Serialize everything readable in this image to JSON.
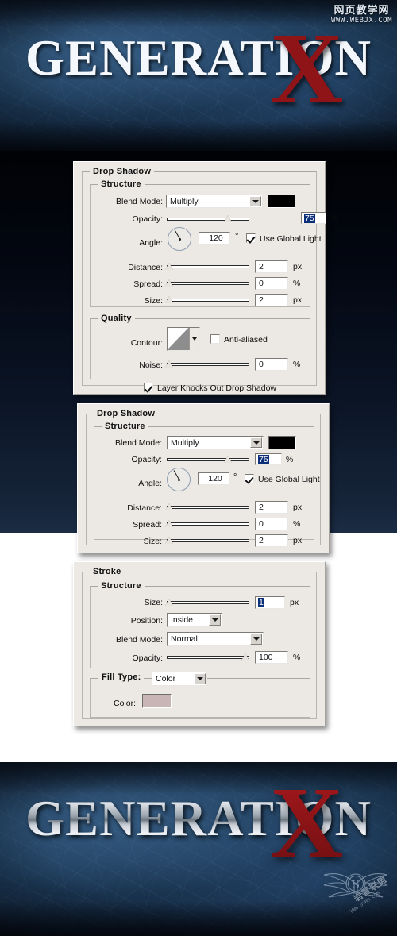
{
  "banners": {
    "top": {
      "wordmark": "GENERATIO N",
      "wordmark_text": "GENERATION",
      "accent_letter": "X",
      "style": "white-serif",
      "bg_color": "#1d3a58",
      "accent_color": "#8e1417"
    },
    "bottom": {
      "wordmark_text": "GENERATION",
      "accent_letter": "X",
      "style": "metallic-silver",
      "bg_color": "#1d3a58",
      "accent_color": "#8e1417"
    }
  },
  "watermarks": {
    "top": {
      "cn": "网页教学网",
      "url": "WWW.WEBJX.COM"
    },
    "bottom": {
      "icon": "winged-s-emblem",
      "cn": "岩冒联盟",
      "url": "WWW.5VHH.COM"
    }
  },
  "dialogs": [
    {
      "id": "drop-shadow-full",
      "title": "Drop Shadow",
      "sections": [
        {
          "title": "Structure",
          "fields": {
            "blend_mode_label": "Blend Mode:",
            "blend_mode_value": "Multiply",
            "blend_mode_color": "#000000",
            "opacity_label": "Opacity:",
            "opacity_value": "75",
            "opacity_unit": "%",
            "angle_label": "Angle:",
            "angle_value": "120",
            "angle_unit": "°",
            "global_light_label": "Use Global Light",
            "global_light_checked": true,
            "distance_label": "Distance:",
            "distance_value": "2",
            "distance_unit": "px",
            "spread_label": "Spread:",
            "spread_value": "0",
            "spread_unit": "%",
            "size_label": "Size:",
            "size_value": "2",
            "size_unit": "px"
          }
        },
        {
          "title": "Quality",
          "fields": {
            "contour_label": "Contour:",
            "antialiased_label": "Anti-aliased",
            "antialiased_checked": false,
            "noise_label": "Noise:",
            "noise_value": "0",
            "noise_unit": "%"
          }
        }
      ],
      "footer": {
        "knockout_label": "Layer Knocks Out Drop Shadow",
        "knockout_checked": true
      }
    },
    {
      "id": "drop-shadow-structure",
      "title": "Drop Shadow",
      "sections": [
        {
          "title": "Structure",
          "fields": {
            "blend_mode_label": "Blend Mode:",
            "blend_mode_value": "Multiply",
            "blend_mode_color": "#000000",
            "opacity_label": "Opacity:",
            "opacity_value": "75",
            "opacity_unit": "%",
            "angle_label": "Angle:",
            "angle_value": "120",
            "angle_unit": "°",
            "global_light_label": "Use Global Light",
            "global_light_checked": true,
            "distance_label": "Distance:",
            "distance_value": "2",
            "distance_unit": "px",
            "spread_label": "Spread:",
            "spread_value": "0",
            "spread_unit": "%",
            "size_label": "Size:",
            "size_value": "2",
            "size_unit": "px"
          }
        }
      ]
    },
    {
      "id": "stroke",
      "title": "Stroke",
      "sections": [
        {
          "title": "Structure",
          "fields": {
            "size_label": "Size:",
            "size_value": "1",
            "size_unit": "px",
            "position_label": "Position:",
            "position_value": "Inside",
            "blend_mode_label": "Blend Mode:",
            "blend_mode_value": "Normal",
            "opacity_label": "Opacity:",
            "opacity_value": "100",
            "opacity_unit": "%"
          }
        },
        {
          "title": "Fill Type:",
          "fields": {
            "fill_type_value": "Color",
            "color_label": "Color:",
            "color_value": "#c9b4b6"
          }
        }
      ]
    }
  ]
}
